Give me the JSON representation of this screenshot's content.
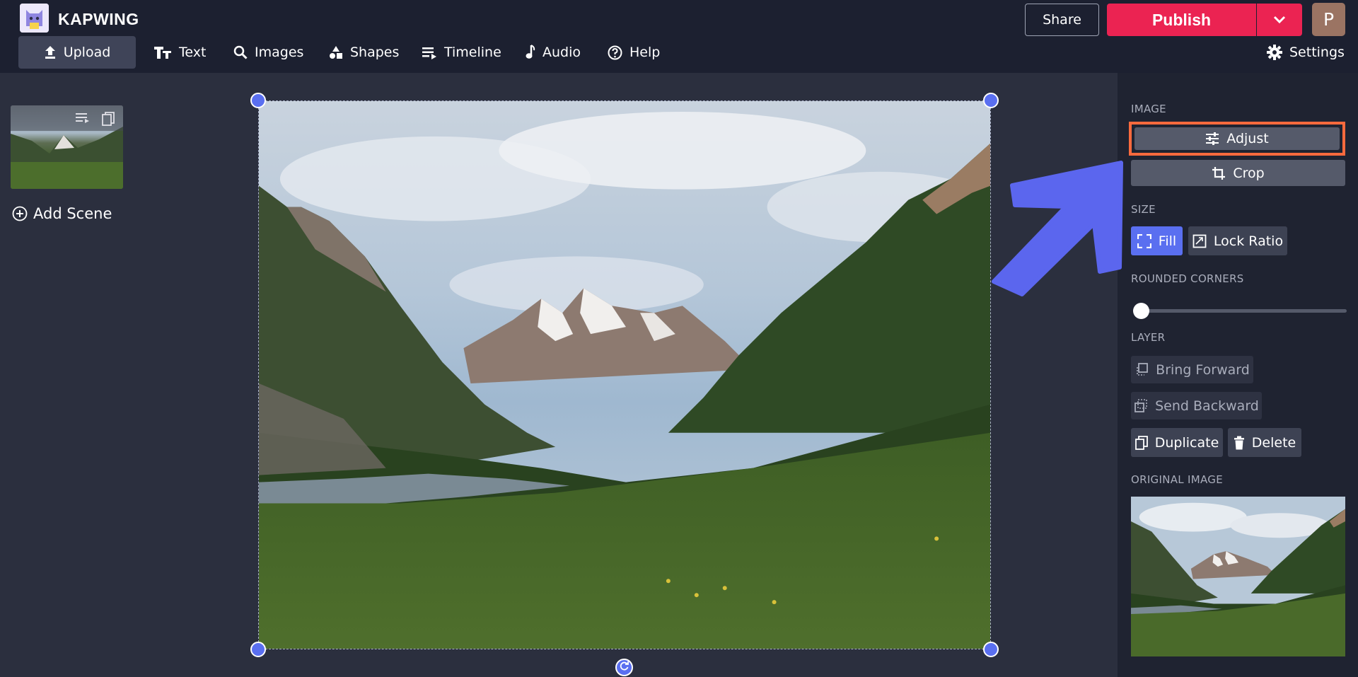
{
  "app": {
    "brand": "KAPWING",
    "share_label": "Share",
    "publish_label": "Publish",
    "avatar_initial": "P"
  },
  "nav": {
    "upload": "Upload",
    "text": "Text",
    "images": "Images",
    "shapes": "Shapes",
    "timeline": "Timeline",
    "audio": "Audio",
    "help": "Help",
    "settings": "Settings"
  },
  "scenes": {
    "add_scene_label": "Add Scene"
  },
  "panel": {
    "image_label": "IMAGE",
    "adjust_label": "Adjust",
    "crop_label": "Crop",
    "size_label": "SIZE",
    "fill_label": "Fill",
    "lock_ratio_label": "Lock Ratio",
    "rounded_corners_label": "ROUNDED CORNERS",
    "rounded_corners_value": 0,
    "layer_label": "LAYER",
    "bring_forward_label": "Bring Forward",
    "send_backward_label": "Send Backward",
    "duplicate_label": "Duplicate",
    "delete_label": "Delete",
    "original_image_label": "ORIGINAL IMAGE"
  },
  "colors": {
    "background": "#2b2f3e",
    "header": "#1c2030",
    "publish": "#eb2352",
    "accent": "#5a6ff0",
    "highlight": "#ff6a3d",
    "arrow": "#5b66ee"
  },
  "icons": {
    "upload": "upload-icon",
    "text": "text-icon",
    "images": "search-icon",
    "shapes": "shapes-icon",
    "timeline": "timeline-icon",
    "audio": "music-note-icon",
    "help": "help-icon",
    "settings": "gear-icon"
  }
}
